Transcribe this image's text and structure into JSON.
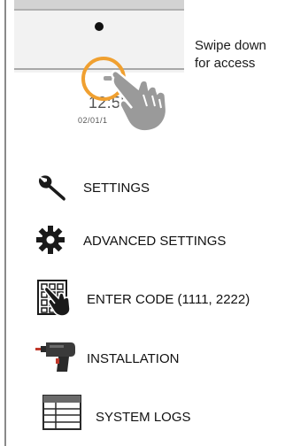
{
  "panel_preview": {
    "clock_time": "12:55",
    "clock_date": "02/01/1",
    "accent_ring_color": "#f0a030",
    "icons": [
      "camera-dot",
      "pull-tab",
      "pointing-hand-icon"
    ]
  },
  "caption": {
    "line1": "Swipe down",
    "line2": "for access"
  },
  "menu": {
    "items": [
      {
        "label": "SETTINGS",
        "icon": "wrench-icon"
      },
      {
        "label": "ADVANCED SETTINGS",
        "icon": "gear-icon"
      },
      {
        "label": "ENTER CODE (1111, 2222)",
        "icon": "keypad-hand-icon"
      },
      {
        "label": "INSTALLATION",
        "icon": "drill-icon"
      },
      {
        "label": "SYSTEM LOGS",
        "icon": "table-grid-icon"
      }
    ]
  }
}
